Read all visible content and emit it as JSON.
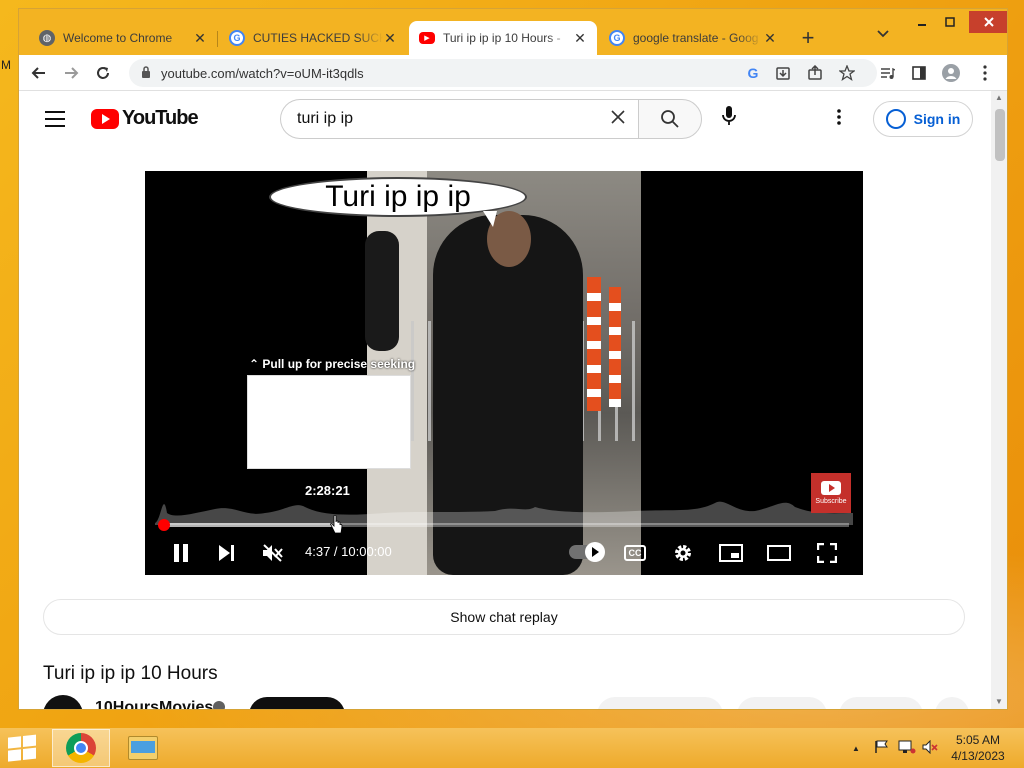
{
  "desktop": {
    "side_text": "M"
  },
  "browser": {
    "tabs": [
      {
        "title": "Welcome to Chrome",
        "icon": "globe-icon",
        "active": false
      },
      {
        "title": "CUTIES HACKED SUCKS",
        "icon": "google-icon",
        "active": false
      },
      {
        "title": "Turi ip ip ip 10 Hours -",
        "icon": "youtube-icon",
        "active": true
      },
      {
        "title": "google translate - Goog",
        "icon": "google-icon",
        "active": false
      }
    ],
    "tab_close": "✕",
    "new_tab": "+",
    "url": "youtube.com/watch?v=oUM-it3qdls"
  },
  "youtube": {
    "logo_text": "YouTube",
    "search_value": "turi ip ip",
    "sign_in_label": "Sign in",
    "player": {
      "caption_text": "Turi ip ip ip",
      "pull_hint": "Pull up for precise seeking",
      "seek_time": "2:28:21",
      "time_display": "4:37 / 10:00:00",
      "subscribe_watermark": "Subscribe",
      "progress_fraction": 0.0077,
      "buffer_fraction": 0.25,
      "cc_label": "CC",
      "icons": [
        "pause-icon",
        "next-icon",
        "mute-icon",
        "autoplay-toggle",
        "captions-icon",
        "settings-icon",
        "miniplayer-icon",
        "theater-icon",
        "fullscreen-icon"
      ]
    },
    "chat_replay_label": "Show chat replay",
    "video_title": "Turi ip ip ip 10 Hours",
    "channel_name": "10HoursMovies"
  },
  "taskbar": {
    "time": "5:05 AM",
    "date": "4/13/2023"
  },
  "colors": {
    "brand_red": "#ff0000",
    "link_blue": "#065fd4",
    "tabstrip": "#f3b322"
  }
}
